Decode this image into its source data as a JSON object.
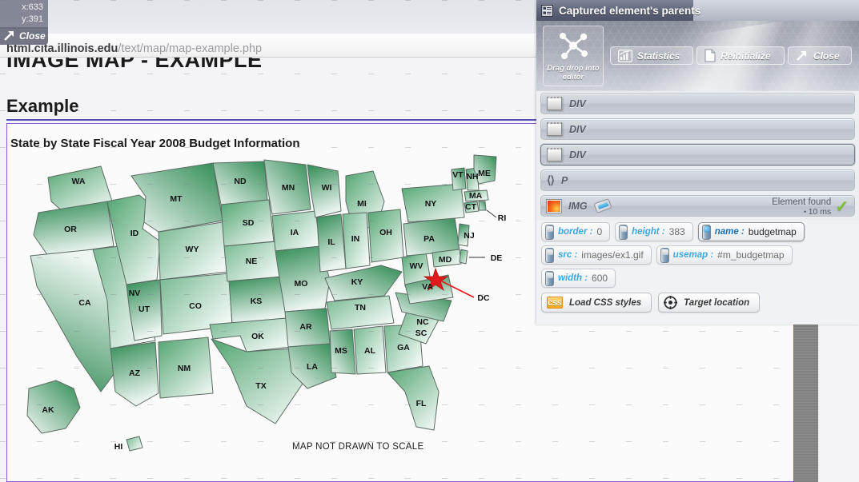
{
  "overlay": {
    "coords": {
      "x_label": "x:633",
      "y_label": "y:391"
    },
    "close_label": "Close",
    "close_icon": "arrow-out-icon"
  },
  "browser": {
    "url_host": "html.cita.illinois.edu",
    "url_path": "/text/map/map-example.php"
  },
  "page": {
    "title_clipped": "IMAGE MAP - EXAMPLE",
    "heading": "Example",
    "map_title": "State by State Fiscal Year 2008 Budget Information",
    "map_note": "MAP NOT DRAWN TO SCALE",
    "accent_rule_color": "#5b4fb8",
    "highlight_box_color": "#8f5bd1"
  },
  "map": {
    "marker_color": "#e01b1b",
    "marker_label": "DC",
    "fill_light": "#eef6f1",
    "fill_dark": "#2f8a55",
    "stroke": "#5b6b62",
    "labels": [
      "WA",
      "OR",
      "ID",
      "MT",
      "ND",
      "MN",
      "WI",
      "MI",
      "NY",
      "VT",
      "NH",
      "MA",
      "CT",
      "RI",
      "ME",
      "NV",
      "UT",
      "WY",
      "SD",
      "IA",
      "IL",
      "IN",
      "OH",
      "PA",
      "NJ",
      "MD",
      "DE",
      "DC",
      "CA",
      "AZ",
      "CO",
      "NE",
      "KS",
      "MO",
      "KY",
      "WV",
      "VA",
      "NC",
      "TN",
      "OK",
      "AR",
      "MS",
      "AL",
      "GA",
      "SC",
      "NM",
      "TX",
      "LA",
      "FL",
      "AK",
      "HI"
    ]
  },
  "panel": {
    "title": "Captured element's parents",
    "title_icon": "list-panel-icon",
    "dragdrop": {
      "label": "Drag drop into editor",
      "icon": "molecule-icon"
    },
    "toolbar": [
      {
        "label": "Statistics",
        "icon": "chart-icon"
      },
      {
        "label": "Reinitialize",
        "icon": "page-icon"
      },
      {
        "label": "Close",
        "icon": "arrow-out-icon"
      }
    ],
    "tree": [
      {
        "tag": "DIV",
        "icon": "div-box-icon",
        "selected": false
      },
      {
        "tag": "DIV",
        "icon": "div-box-icon",
        "selected": false
      },
      {
        "tag": "DIV",
        "icon": "div-box-icon",
        "selected": true
      },
      {
        "tag": "P",
        "icon": "code-brackets-icon",
        "selected": false
      },
      {
        "tag": "IMG",
        "icon": "image-icon",
        "selected": false,
        "extra_icon": "tag-icon",
        "status": "Element found",
        "timing": "10 ms",
        "status_icon": "green-check-icon"
      }
    ],
    "attributes": [
      {
        "key": "border :",
        "value": "0",
        "active": false
      },
      {
        "key": "height :",
        "value": "383",
        "active": false
      },
      {
        "key": "name :",
        "value": "budgetmap",
        "active": true
      },
      {
        "key": "src :",
        "value": "images/ex1.gif",
        "active": false
      },
      {
        "key": "usemap :",
        "value": "#m_budgetmap",
        "active": false
      },
      {
        "key": "width :",
        "value": "600",
        "active": false
      }
    ],
    "actions": [
      {
        "label": "Load CSS styles",
        "icon": "css-icon"
      },
      {
        "label": "Target location",
        "icon": "crosshair-icon"
      }
    ]
  }
}
